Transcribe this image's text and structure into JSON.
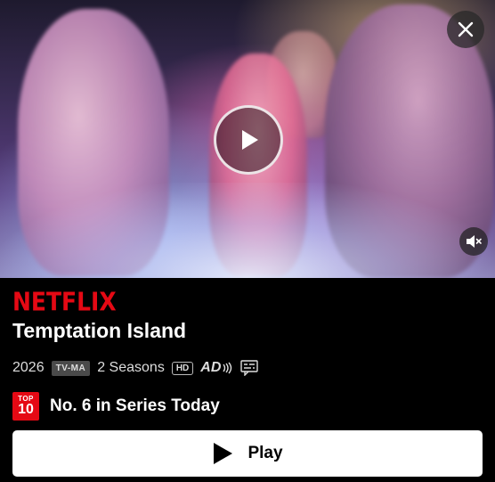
{
  "brand": {
    "logo_text": "NETFLIX",
    "color": "#e50914"
  },
  "title": "Temptation Island",
  "meta": {
    "year": "2026",
    "rating": "TV-MA",
    "seasons": "2 Seasons",
    "quality": "HD",
    "audio_description": "AD",
    "icons": [
      "audio-description-icon",
      "subtitles-icon"
    ]
  },
  "top10": {
    "badge_top": "TOP",
    "badge_bottom": "10",
    "text": "No. 6 in Series Today"
  },
  "actions": {
    "play_label": "Play"
  },
  "player": {
    "icons": [
      "close-icon",
      "play-icon",
      "mute-icon"
    ]
  }
}
